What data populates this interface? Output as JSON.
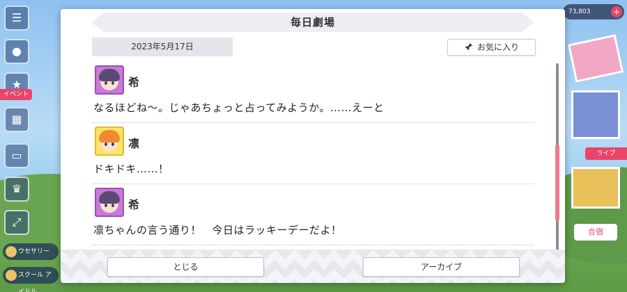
{
  "modal": {
    "title": "毎日劇場",
    "date": "2023年5月17日",
    "favorite_label": "お気に入り",
    "close_label": "とじる",
    "archive_label": "アーカイブ"
  },
  "dialogue": [
    {
      "speaker": "希",
      "text": "なるほどね〜。じゃあちょっと占ってみようか。……えーと",
      "avatar_color": "#c979d6"
    },
    {
      "speaker": "凛",
      "text": "ドキドキ……！",
      "avatar_color": "#ffe36b"
    },
    {
      "speaker": "希",
      "text": "凛ちゃんの言う通り！　今日はラッキーデーだよ！",
      "avatar_color": "#c979d6"
    }
  ],
  "background": {
    "left_tag": "イベント",
    "chip_1": "ウセサリー",
    "chip_2": "スクール\nアイドル",
    "right_tag": "ライブ",
    "right_button": "合宿",
    "ticket_label": "73,803"
  },
  "colors": {
    "accent": "#f07a8e",
    "title_bar": "#eceef3",
    "date_pill": "#e4e5ea"
  }
}
